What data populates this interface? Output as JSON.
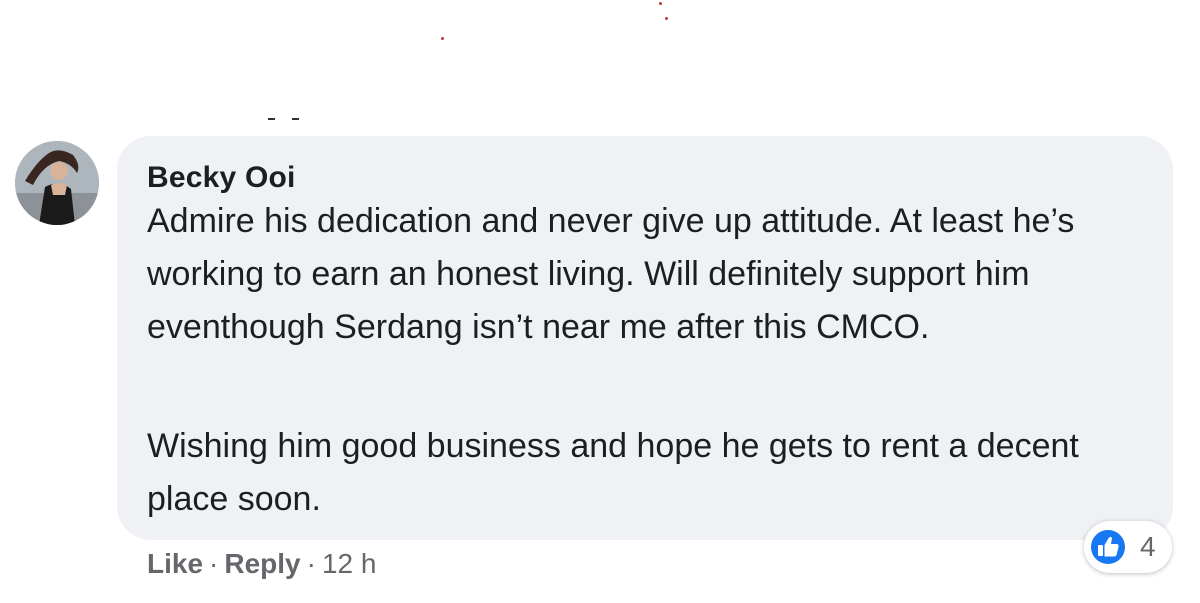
{
  "comment": {
    "author": "Becky Ooi",
    "paragraphs": [
      "Admire his dedication and never give up attitude. At least he’s working to earn an honest living. Will definitely support him eventhough Serdang isn’t near me after this CMCO.",
      "Wishing him good business and hope he gets to rent a decent place soon."
    ],
    "actions": {
      "like": "Like",
      "reply": "Reply",
      "separator": "·",
      "time": "12 h"
    },
    "reactions": {
      "icon": "thumbs-up-icon",
      "count": "4"
    }
  },
  "colors": {
    "bubble": "#eff1f4",
    "text": "#1c1e21",
    "secondary_text": "#65676b",
    "like_blue": "#1877f2"
  }
}
